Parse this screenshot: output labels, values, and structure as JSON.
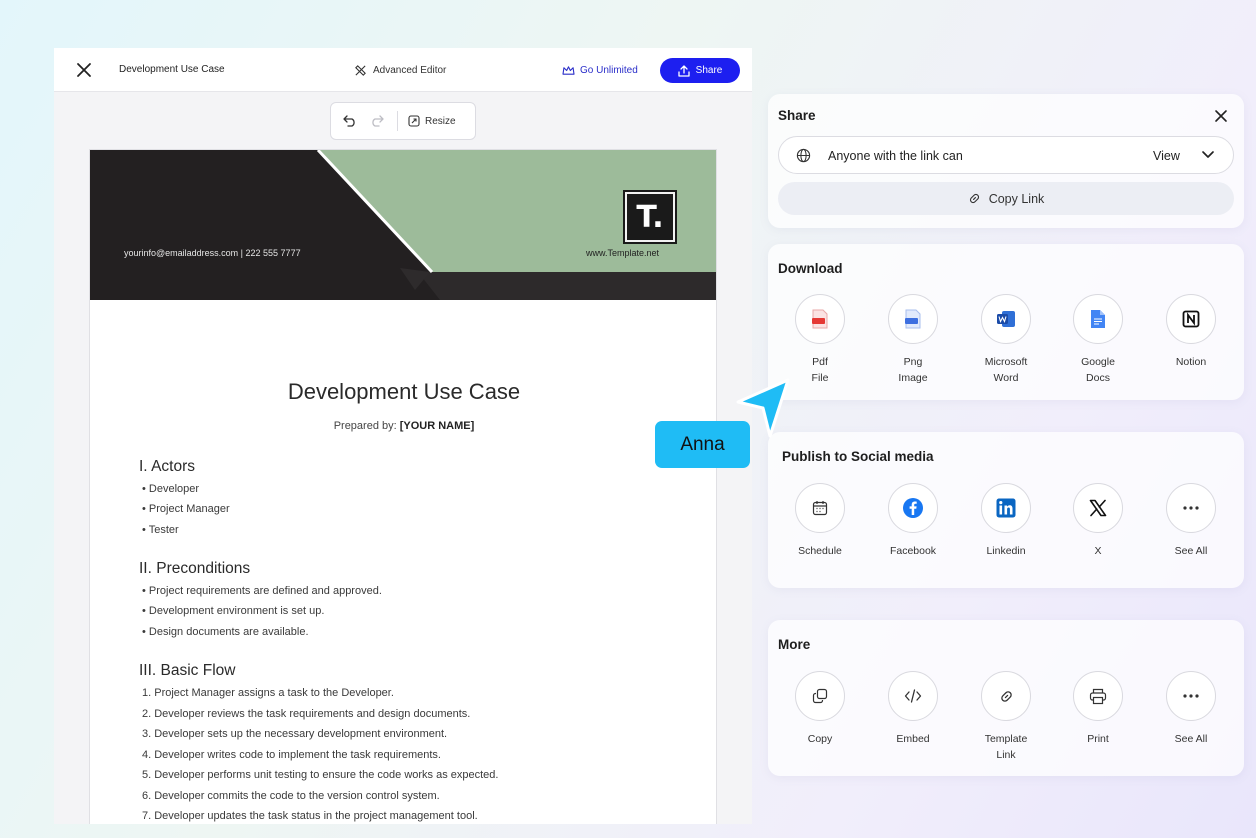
{
  "topbar": {
    "doc_title": "Development Use Case",
    "advanced_editor": "Advanced Editor",
    "go_unlimited": "Go Unlimited",
    "share": "Share"
  },
  "toolbar": {
    "resize": "Resize"
  },
  "document": {
    "banner": {
      "contact": "yourinfo@emailaddress.com  |  222 555 7777",
      "website": "www.Template.net",
      "logo": "T."
    },
    "heading": "Development Use Case",
    "prepared_label": "Prepared by: ",
    "prepared_value": "[YOUR NAME]",
    "sections": [
      {
        "title": "I. Actors",
        "items": [
          "• Developer",
          "• Project Manager",
          "• Tester"
        ]
      },
      {
        "title": "II. Preconditions",
        "items": [
          "• Project requirements are defined and approved.",
          "• Development environment is set up.",
          "• Design documents are available."
        ]
      },
      {
        "title": "III. Basic Flow",
        "items": [
          "1. Project Manager assigns a task to the Developer.",
          "2. Developer reviews the task requirements and design documents.",
          "3. Developer sets up the necessary development environment.",
          "4. Developer writes code to implement the task requirements.",
          "5. Developer performs unit testing to ensure the code works as expected.",
          "6. Developer commits the code to the version control system.",
          "7. Developer updates the task status in the project management tool."
        ]
      }
    ]
  },
  "share_panel": {
    "title": "Share",
    "access_text": "Anyone with the link can",
    "access_value": "View",
    "copy_link": "Copy Link"
  },
  "download_panel": {
    "title": "Download",
    "options": [
      {
        "line1": "Pdf",
        "line2": "File",
        "icon": "pdf-file-icon"
      },
      {
        "line1": "Png",
        "line2": "Image",
        "icon": "png-image-icon"
      },
      {
        "line1": "Microsoft",
        "line2": "Word",
        "icon": "microsoft-word-icon"
      },
      {
        "line1": "Google",
        "line2": "Docs",
        "icon": "google-docs-icon"
      },
      {
        "line1": "Notion",
        "line2": "",
        "icon": "notion-icon"
      }
    ]
  },
  "social_panel": {
    "title": "Publish to Social media",
    "options": [
      {
        "label": "Schedule",
        "icon": "calendar-icon"
      },
      {
        "label": "Facebook",
        "icon": "facebook-icon"
      },
      {
        "label": "Linkedin",
        "icon": "linkedin-icon"
      },
      {
        "label": "X",
        "icon": "x-icon"
      },
      {
        "label": "See All",
        "icon": "more-icon"
      }
    ]
  },
  "more_panel": {
    "title": "More",
    "options": [
      {
        "label": "Copy",
        "icon": "copy-icon"
      },
      {
        "label": "Embed",
        "icon": "code-icon"
      },
      {
        "label": "Template Link",
        "icon": "link-icon"
      },
      {
        "label": "Print",
        "icon": "printer-icon"
      },
      {
        "label": "See All",
        "icon": "more-icon"
      }
    ]
  },
  "cursor": {
    "name": "Anna"
  },
  "colors": {
    "accent": "#1d1ff0",
    "banner_dark": "#232021",
    "banner_green": "#9dbb9a",
    "cursor": "#1fbcf5"
  }
}
